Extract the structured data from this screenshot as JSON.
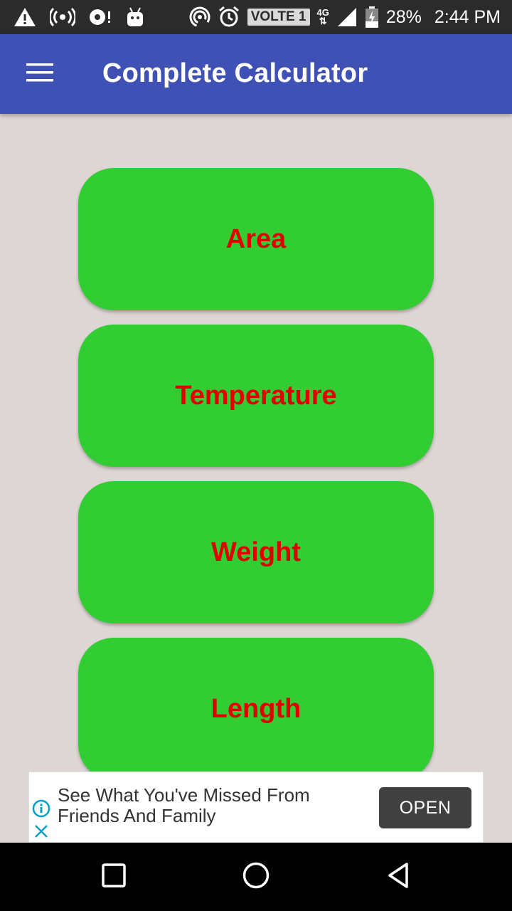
{
  "status_bar": {
    "volte": "VOLTE 1",
    "network": "4G",
    "battery": "28%",
    "time": "2:44 PM",
    "icons": [
      "warning-icon",
      "hotspot-icon",
      "sync-alert-icon",
      "android-icon",
      "wifi-tether-icon",
      "alarm-icon",
      "signal-icon",
      "battery-charging-icon"
    ]
  },
  "app_bar": {
    "title": "Complete Calculator",
    "menu_icon": "hamburger-menu-icon"
  },
  "buttons": [
    {
      "label": "Area"
    },
    {
      "label": "Temperature"
    },
    {
      "label": "Weight"
    },
    {
      "label": "Length"
    }
  ],
  "ad": {
    "text": "See What You've Missed From Friends And Family",
    "cta": "OPEN",
    "info_icon": "info-icon",
    "close_icon": "close-icon"
  },
  "nav_bar": {
    "icons": [
      "recents-icon",
      "home-icon",
      "back-icon"
    ]
  },
  "colors": {
    "app_bar": "#3f51b5",
    "button_bg": "#32cd32",
    "button_text": "#e00000",
    "background": "#ded5d5"
  }
}
